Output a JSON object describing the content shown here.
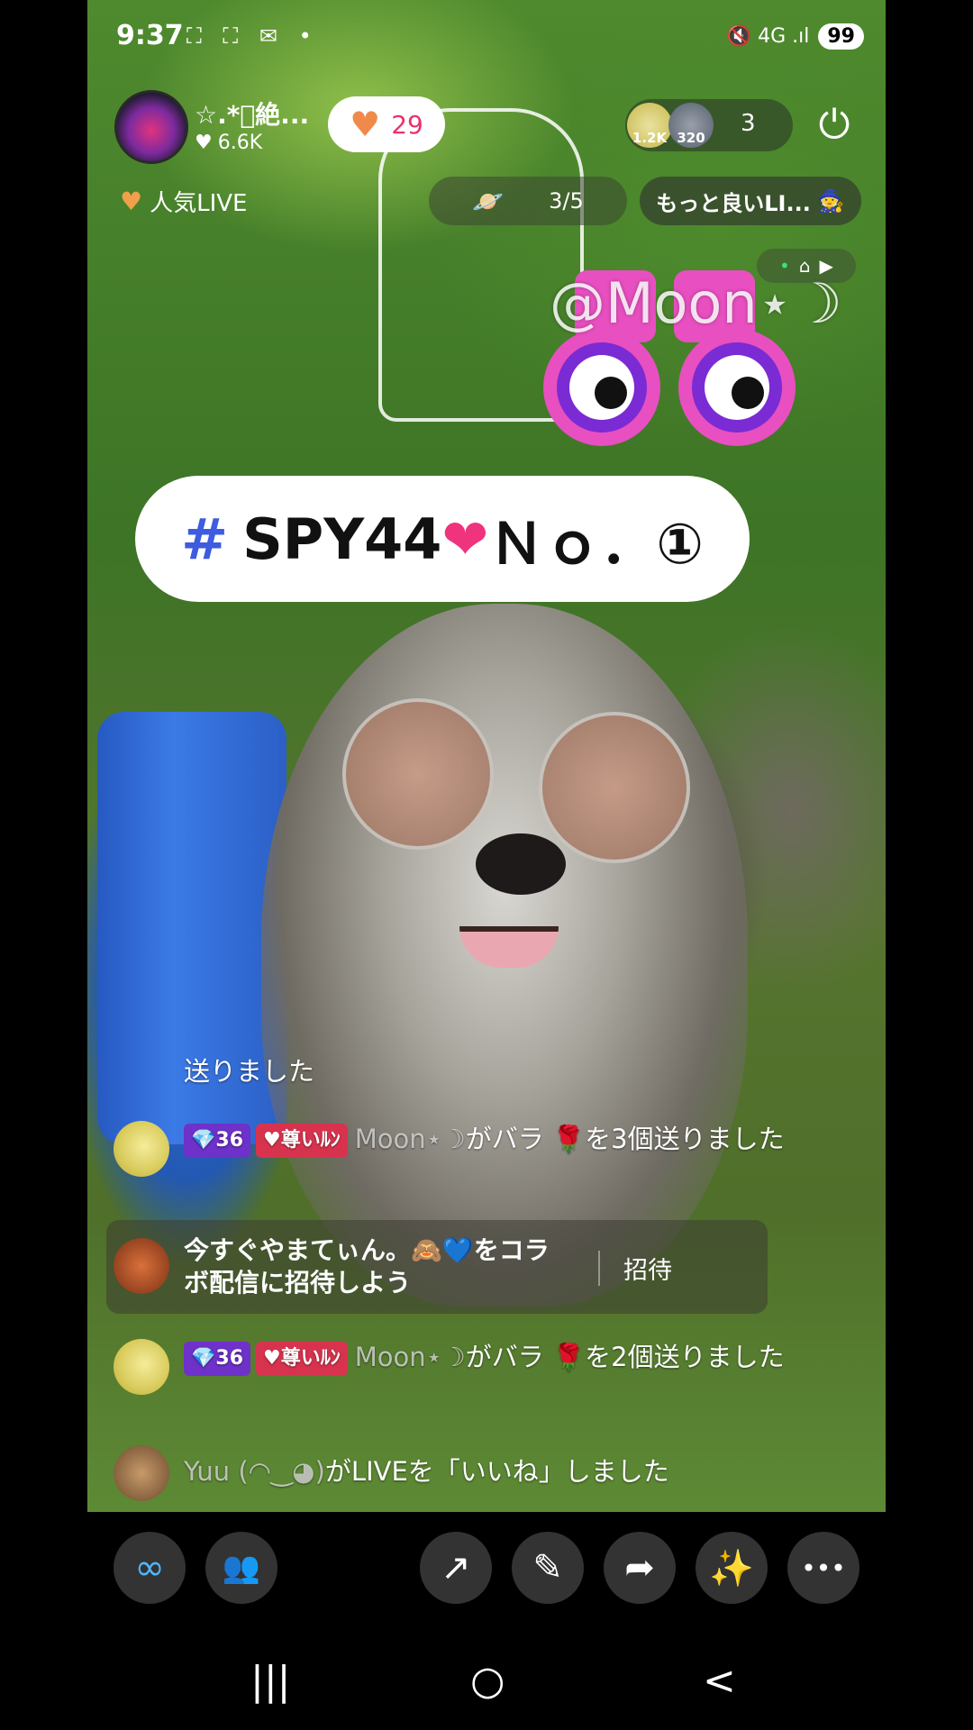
{
  "status_bar": {
    "time": "9:37",
    "left_icons": "⛶ ⛶ ✉ •",
    "signal": "🔇 4G .ıl",
    "battery": "99"
  },
  "host": {
    "name": "☆.*ﾟ絶...",
    "likes": "6.6K"
  },
  "like_pill": {
    "icon": "heart-icon",
    "count": "29"
  },
  "viewers": {
    "avatar1_label": "1.2K",
    "avatar2_label": "320",
    "count": "3"
  },
  "popular_label": "人気LIVE",
  "task_pill": {
    "progress": "3/5"
  },
  "better_pill": {
    "label": "もっと良いLI..."
  },
  "watermark": "@Moon⋆☽",
  "tag_banner": {
    "hash": "#",
    "text_before": "SPY44",
    "heart": "❤",
    "text_after": "Ｎｏ．①"
  },
  "chat": {
    "line0": "送りました",
    "line1": {
      "level": "💎36",
      "fan_badge": "♥尊いﾙﾝ",
      "user": "Moon⋆☽",
      "text_a": "がバラ",
      "rose": "🌹",
      "text_b": "を3個送りました"
    },
    "invite": {
      "text": "今すぐやまてぃん。🙈💙をコラボ配信に招待しよう",
      "button": "招待"
    },
    "line2": {
      "level": "💎36",
      "fan_badge": "♥尊いﾙﾝ",
      "user": "Moon⋆☽",
      "text_a": "がバラ",
      "rose": "🌹",
      "text_b": "を2個送りました"
    },
    "line3": {
      "user": "Yuu (◠‿◕)",
      "text": "がLIVEを「いいね」しました"
    }
  },
  "toolbar": {
    "collab": "∞",
    "guests": "👥",
    "share_post": "↗",
    "comment": "✎",
    "share": "➦",
    "effects": "✨",
    "more": "•••"
  },
  "navbar": {
    "recents": "|||",
    "home": "○",
    "back": "<"
  }
}
